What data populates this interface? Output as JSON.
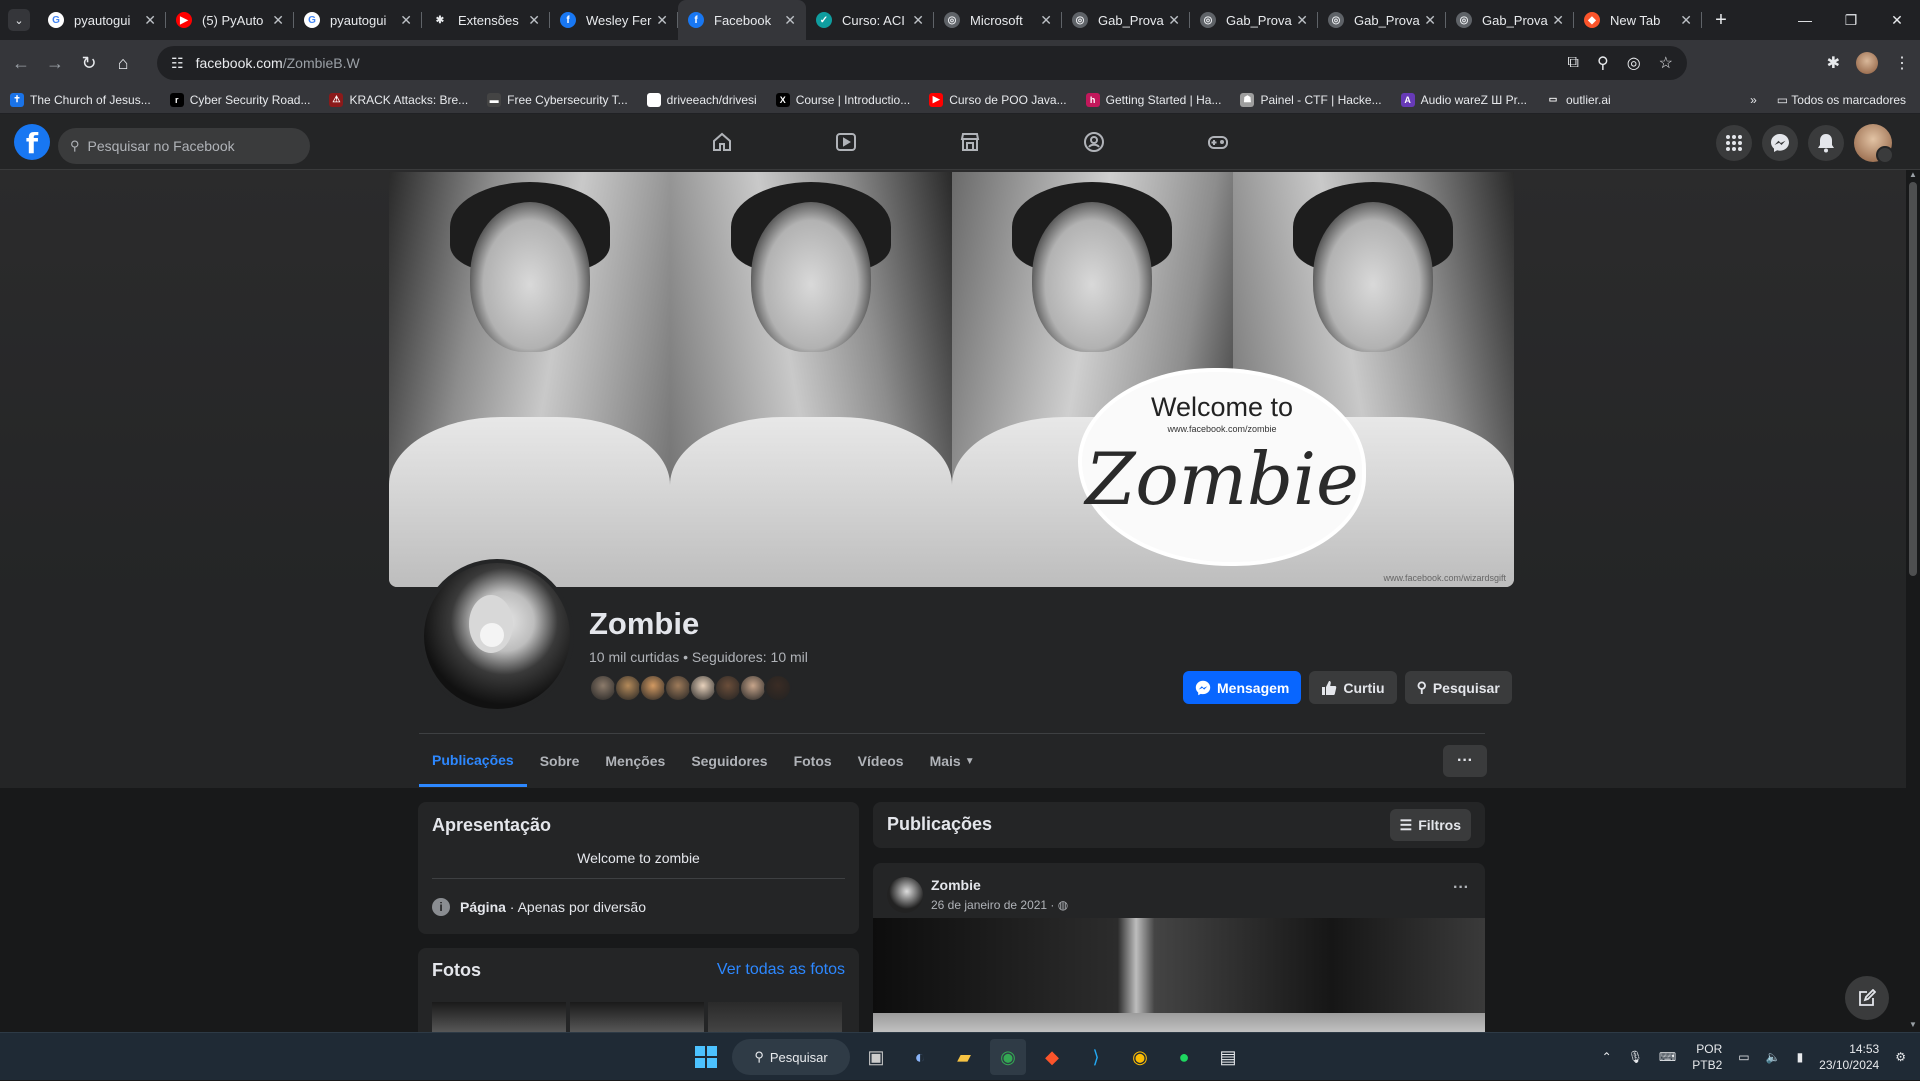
{
  "browser": {
    "tabs": [
      {
        "title": "pyautogui",
        "icon": "google-icon",
        "color": "#ffffff",
        "glyph": "G",
        "glyph_color": "#4285f4"
      },
      {
        "title": "(5) PyAuto",
        "icon": "youtube-icon",
        "color": "#ff0000",
        "glyph": "▶",
        "glyph_color": "#ffffff"
      },
      {
        "title": "pyautogui",
        "icon": "google-icon",
        "color": "#ffffff",
        "glyph": "G",
        "glyph_color": "#4285f4"
      },
      {
        "title": "Extensões",
        "icon": "puzzle-icon",
        "color": "#202124",
        "glyph": "✱",
        "glyph_color": "#e8eaed"
      },
      {
        "title": "Wesley Fer",
        "icon": "facebook-icon",
        "color": "#1877f2",
        "glyph": "f",
        "glyph_color": "#ffffff"
      },
      {
        "title": "Facebook",
        "icon": "facebook-icon",
        "color": "#1877f2",
        "glyph": "f",
        "glyph_color": "#ffffff",
        "active": true
      },
      {
        "title": "Curso: ACI",
        "icon": "course-icon",
        "color": "#0f9d9f",
        "glyph": "✓",
        "glyph_color": "#ffffff"
      },
      {
        "title": "Microsoft",
        "icon": "globe-icon",
        "color": "#5f6368",
        "glyph": "◎",
        "glyph_color": "#e8eaed"
      },
      {
        "title": "Gab_Prova",
        "icon": "globe-icon",
        "color": "#5f6368",
        "glyph": "◎",
        "glyph_color": "#e8eaed"
      },
      {
        "title": "Gab_Prova",
        "icon": "globe-icon",
        "color": "#5f6368",
        "glyph": "◎",
        "glyph_color": "#e8eaed"
      },
      {
        "title": "Gab_Prova",
        "icon": "globe-icon",
        "color": "#5f6368",
        "glyph": "◎",
        "glyph_color": "#e8eaed"
      },
      {
        "title": "Gab_Prova",
        "icon": "globe-icon",
        "color": "#5f6368",
        "glyph": "◎",
        "glyph_color": "#e8eaed"
      },
      {
        "title": "New Tab",
        "icon": "brave-icon",
        "color": "#fb542b",
        "glyph": "◆",
        "glyph_color": "#ffffff"
      }
    ],
    "url_domain": "facebook.com",
    "url_path": "/ZombieB.W",
    "bookmarks": [
      {
        "label": "The Church of Jesus...",
        "icon": "church-icon",
        "color": "#1a73e8",
        "glyph": "✝"
      },
      {
        "label": "Cyber Security Road...",
        "icon": "roadmap-icon",
        "color": "#000000",
        "glyph": "r"
      },
      {
        "label": "KRACK Attacks: Bre...",
        "icon": "krack-icon",
        "color": "#8b1a1a",
        "glyph": "⚠"
      },
      {
        "label": "Free Cybersecurity T...",
        "icon": "cyber-icon",
        "color": "#444444",
        "glyph": "▬"
      },
      {
        "label": "driveeach/drivesi",
        "icon": "github-icon",
        "color": "#ffffff",
        "glyph": "●"
      },
      {
        "label": "Course | Introductio...",
        "icon": "x-icon",
        "color": "#000000",
        "glyph": "X"
      },
      {
        "label": "Curso de POO Java...",
        "icon": "youtube-icon",
        "color": "#ff0000",
        "glyph": "▶"
      },
      {
        "label": "Getting Started | Ha...",
        "icon": "hackthebox-icon",
        "color": "#c2185b",
        "glyph": "h"
      },
      {
        "label": "Painel - CTF | Hacke...",
        "icon": "ctf-icon",
        "color": "#9e9e9e",
        "glyph": "☗"
      },
      {
        "label": "Audio wareZ Ш Pr...",
        "icon": "audiowarez-icon",
        "color": "#673ab7",
        "glyph": "A"
      },
      {
        "label": "outlier.ai",
        "icon": "folder-icon",
        "color": "#35363a",
        "glyph": "▭"
      }
    ],
    "all_bookmarks": "Todos os marcadores"
  },
  "facebook": {
    "search_placeholder": "Pesquisar no Facebook",
    "page": {
      "name": "Zombie",
      "stats": "10 mil curtidas • Seguidores: 10 mil",
      "buttons": {
        "message": "Mensagem",
        "liked": "Curtiu",
        "search": "Pesquisar"
      },
      "tabs": [
        "Publicações",
        "Sobre",
        "Menções",
        "Seguidores",
        "Fotos",
        "Vídeos",
        "Mais"
      ],
      "active_tab": "Publicações",
      "cover": {
        "line1": "Welcome to",
        "line2": "www.facebook.com/zombie",
        "line3": "Zombie",
        "credit": "www.facebook.com/wizardsgift"
      },
      "friend_colors": [
        "#8c7b6b",
        "#b48a5a",
        "#d39a62",
        "#9e7b5a",
        "#e8d2bc",
        "#6b4e3a",
        "#c7a58b",
        "#3a2c24"
      ]
    },
    "intro": {
      "title": "Apresentação",
      "bio": "Welcome to zombie",
      "category_label": "Página",
      "category_value": " · Apenas por diversão"
    },
    "photos": {
      "title": "Fotos",
      "link": "Ver todas as fotos"
    },
    "posts": {
      "title": "Publicações",
      "filter": "Filtros",
      "first": {
        "author": "Zombie",
        "date": "26 de janeiro de 2021 · ◍"
      }
    }
  },
  "taskbar": {
    "search": "Pesquisar",
    "lang_top": "POR",
    "lang_bottom": "PTB2",
    "time": "14:53",
    "date": "23/10/2024"
  }
}
